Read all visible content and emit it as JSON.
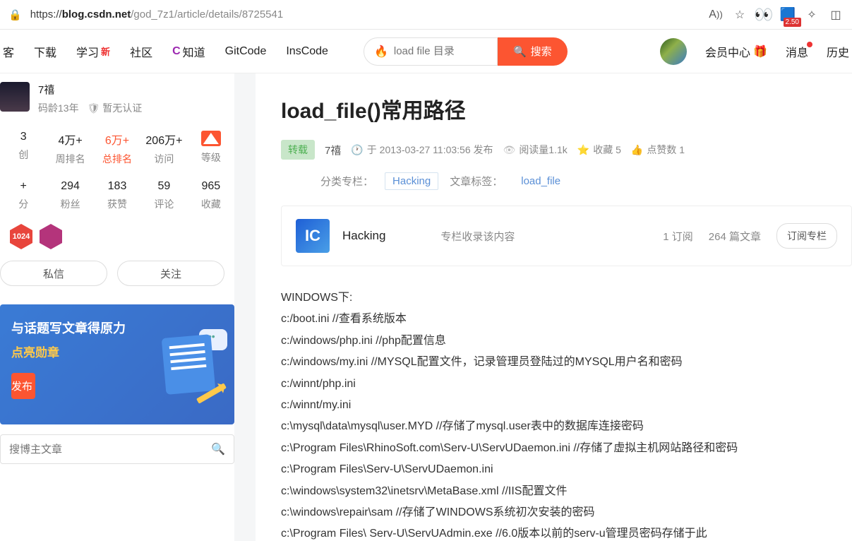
{
  "browser": {
    "url_domain": "blog.csdn.net",
    "url_prefix": "https://",
    "url_path": "/god_7z1/article/details/8725541",
    "ext_badge": "2.50"
  },
  "nav": {
    "items": [
      "客",
      "下载",
      "学习",
      "社区",
      "知道",
      "GitCode",
      "InsCode"
    ],
    "learn_new": "新",
    "search_placeholder": "load file 目录",
    "search_btn": "搜索",
    "member": "会员中心",
    "msg": "消息",
    "history": "历史"
  },
  "sidebar": {
    "name": "7禧",
    "age": "码龄13年",
    "cert": "暂无认证",
    "stats1": [
      {
        "val": "3",
        "lbl": "创"
      },
      {
        "val": "4万+",
        "lbl": "周排名"
      },
      {
        "val": "6万+",
        "lbl": "总排名"
      },
      {
        "val": "206万+",
        "lbl": "访问"
      },
      {
        "val": "",
        "lbl": "等级"
      }
    ],
    "stats2": [
      {
        "val": "+",
        "lbl": "分"
      },
      {
        "val": "294",
        "lbl": "粉丝"
      },
      {
        "val": "183",
        "lbl": "获赞"
      },
      {
        "val": "59",
        "lbl": "评论"
      },
      {
        "val": "965",
        "lbl": "收藏"
      }
    ],
    "badge1": "1024",
    "msg_btn": "私信",
    "follow_btn": "关注",
    "promo_title": "与话题写文章得原力",
    "promo_sub": "点亮勋章",
    "promo_btn": "发布",
    "search_ph": "搜博主文章"
  },
  "article": {
    "title": "load_file()常用路径",
    "repost": "转载",
    "author": "7禧",
    "time": "于 2013-03-27 11:03:56 发布",
    "views": "阅读量1.1k",
    "fav": "收藏 5",
    "likes": "点赞数 1",
    "cat_lbl": "分类专栏：",
    "cat_link": "Hacking",
    "tag_lbl": "文章标签：",
    "tag_link": "load_file",
    "col_name": "Hacking",
    "col_desc": "专栏收录该内容",
    "col_sub": "1 订阅",
    "col_count": "264 篇文章",
    "col_btn": "订阅专栏",
    "body": [
      "WINDOWS下:",
      "c:/boot.ini          //查看系统版本",
      "c:/windows/php.ini   //php配置信息",
      "c:/windows/my.ini    //MYSQL配置文件，记录管理员登陆过的MYSQL用户名和密码",
      "c:/winnt/php.ini",
      "c:/winnt/my.ini",
      "c:\\mysql\\data\\mysql\\user.MYD  //存储了mysql.user表中的数据库连接密码",
      "c:\\Program Files\\RhinoSoft.com\\Serv-U\\ServUDaemon.ini  //存储了虚拟主机网站路径和密码",
      "c:\\Program Files\\Serv-U\\ServUDaemon.ini",
      "c:\\windows\\system32\\inetsrv\\MetaBase.xml  //IIS配置文件",
      "c:\\windows\\repair\\sam  //存储了WINDOWS系统初次安装的密码",
      "c:\\Program Files\\ Serv-U\\ServUAdmin.exe  //6.0版本以前的serv-u管理员密码存储于此"
    ]
  }
}
